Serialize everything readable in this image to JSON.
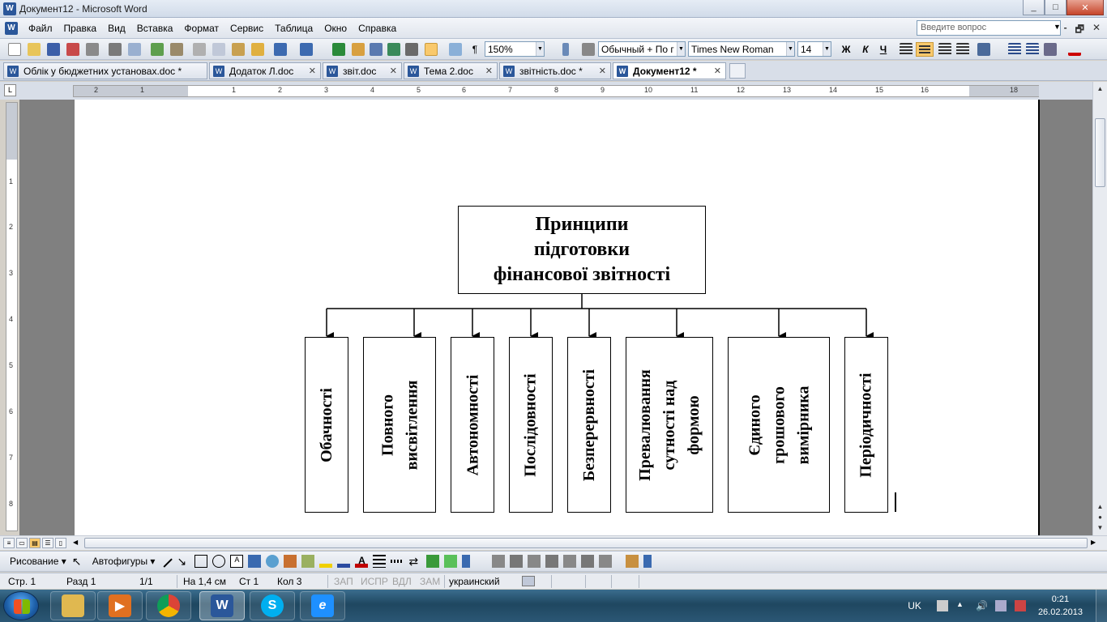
{
  "window": {
    "title": "Документ12 - Microsoft Word",
    "minimize": "_",
    "maximize": "□",
    "close": "✕"
  },
  "menu": {
    "items": [
      "Файл",
      "Правка",
      "Вид",
      "Вставка",
      "Формат",
      "Сервис",
      "Таблица",
      "Окно",
      "Справка"
    ],
    "help_placeholder": "Введите вопрос",
    "doc_controls": [
      "‑",
      "🗗",
      "✕"
    ]
  },
  "toolbar": {
    "zoom": "150%",
    "style": "Обычный + По г",
    "font": "Times New Roman",
    "size": "14",
    "bold": "Ж",
    "italic": "К",
    "underline": "Ч",
    "pilcrow": "¶"
  },
  "tabs": [
    {
      "label": "Облік у бюджетних установах.doc  *",
      "active": false
    },
    {
      "label": "Додаток Л.doc",
      "active": false
    },
    {
      "label": "звіт.doc",
      "active": false
    },
    {
      "label": "Тема 2.doc",
      "active": false
    },
    {
      "label": "звітність.doc  *",
      "active": false
    },
    {
      "label": "Документ12  *",
      "active": true
    }
  ],
  "ruler": {
    "h_numbers": [
      "2",
      "1",
      "1",
      "2",
      "3",
      "4",
      "5",
      "6",
      "7",
      "8",
      "9",
      "10",
      "11",
      "12",
      "13",
      "14",
      "15",
      "16",
      "18"
    ],
    "v_numbers": [
      "1",
      "1",
      "2",
      "3",
      "4",
      "5",
      "6",
      "7",
      "8"
    ],
    "corner": "L"
  },
  "diagram": {
    "title": "Принципи\nпідготовки\nфінансової звітності",
    "items": [
      "Обачності",
      "Повного\nвисвітлення",
      "Автономності",
      "Послідовності",
      "Безперервності",
      "Превалювання\nсутності над\nформою",
      "Єдиного\nгрошового\nвимірника",
      "Періодичності"
    ]
  },
  "drawing_toolbar": {
    "draw": "Рисование ▾",
    "autoshapes": "Автофигуры ▾"
  },
  "status": {
    "page": "Стр. 1",
    "section": "Разд 1",
    "pages": "1/1",
    "position": "На 1,4 см",
    "line": "Ст 1",
    "column": "Кол 3",
    "rec": "ЗАП",
    "trk": "ИСПР",
    "ext": "ВДЛ",
    "ovr": "ЗАМ",
    "language": "украинский"
  },
  "taskbar": {
    "lang": "UK",
    "time": "0:21",
    "date": "26.02.2013"
  },
  "colors": {
    "word_blue": "#2b579a",
    "active_button": "#f9c96c",
    "doc_gray": "#808080"
  }
}
